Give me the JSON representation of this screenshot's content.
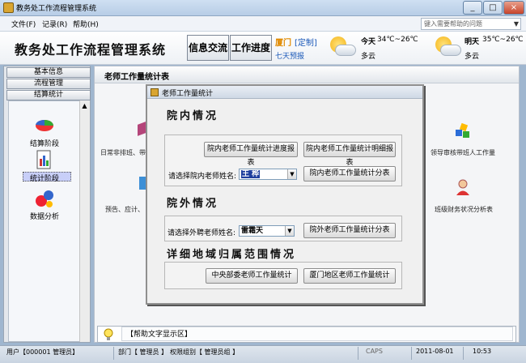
{
  "window": {
    "title": "教务处工作流程管理系统",
    "buttons": [
      "_",
      "□",
      "×"
    ]
  },
  "menu": {
    "items": [
      "文件(F)",
      "记录(R)",
      "帮助(H)"
    ],
    "search_placeholder": "键入需要帮助的问题"
  },
  "header": {
    "app_title": "教务处工作流程管理系统",
    "btn_info": "信息交流",
    "btn_progress": "工作进度",
    "city": "厦门",
    "custom": "[定制]",
    "forecast": "七天预报",
    "today_label": "今天",
    "today_temp": "34℃~26℃",
    "today_desc": "多云",
    "tomorrow_label": "明天",
    "tomorrow_temp": "35℃~26℃",
    "tomorrow_desc": "多云"
  },
  "sidebar": {
    "headers": [
      "基本信息",
      "流程管理",
      "结算统计"
    ],
    "items": [
      {
        "label": "结算阶段",
        "icon": "pie-chart-icon"
      },
      {
        "label": "统计阶段",
        "icon": "document-chart-icon"
      },
      {
        "label": "数据分析",
        "icon": "bubble-chart-icon"
      }
    ]
  },
  "main": {
    "title": "老师工作量统计表",
    "bg_labels": [
      "日常非排班、带",
      "预告、应计、",
      "领导审核带班人工作量",
      "班级财务状况分析表"
    ]
  },
  "dialog": {
    "title": "老师工作量统计",
    "section_internal": "院内情况",
    "btn_internal_progress": "院内老师工作量统计进度报表",
    "btn_internal_detail": "院内老师工作量统计明细报表",
    "label_internal_name": "请选择院内老师姓名:",
    "internal_name": "王 桦",
    "btn_internal_split": "院内老师工作量统计分表",
    "section_external": "院外情况",
    "label_external_name": "请选择外聘老师姓名:",
    "external_name": "雷霜天",
    "btn_external_split": "院外老师工作量统计分表",
    "section_region": "详细地域归属范围情况",
    "btn_central": "中央部委老师工作量统计",
    "btn_xiamen": "厦门地区老师工作量统计"
  },
  "helpbar": {
    "text": "【帮助文字显示区】"
  },
  "status": {
    "user": "用户【000001  管理员】",
    "dept": "部门【 管理员 】",
    "role": "权限组别【 管理员组 】",
    "caps": "CAPS",
    "date": "2011-08-01",
    "time": "10:53"
  },
  "colors": {
    "accent_orange": "#e08a00",
    "link_blue": "#1a58b8",
    "selection": "#1f3f9e"
  }
}
